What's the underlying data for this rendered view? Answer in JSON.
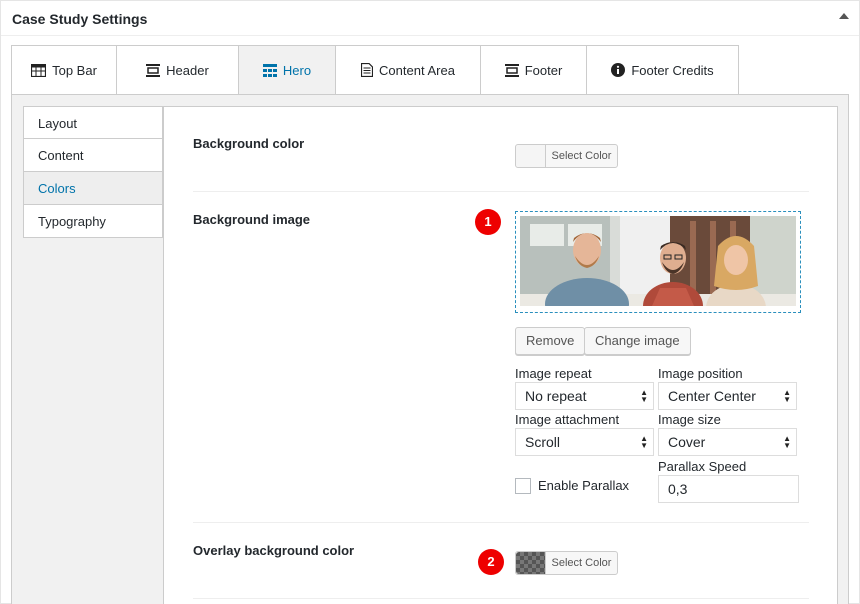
{
  "panel": {
    "title": "Case Study Settings"
  },
  "tabs": [
    {
      "label": "Top Bar",
      "icon": "table-icon"
    },
    {
      "label": "Header",
      "icon": "align-center-icon"
    },
    {
      "label": "Hero",
      "icon": "grid-icon"
    },
    {
      "label": "Content Area",
      "icon": "document-icon"
    },
    {
      "label": "Footer",
      "icon": "align-bottom-icon"
    },
    {
      "label": "Footer Credits",
      "icon": "info-icon"
    }
  ],
  "sidenav": [
    {
      "label": "Layout"
    },
    {
      "label": "Content"
    },
    {
      "label": "Colors"
    },
    {
      "label": "Typography"
    }
  ],
  "fields": {
    "bg_color_label": "Background color",
    "bg_color_button": "Select Color",
    "bg_image_label": "Background image",
    "remove_button": "Remove",
    "change_image_button": "Change image",
    "image_repeat_label": "Image repeat",
    "image_repeat_value": "No repeat",
    "image_position_label": "Image position",
    "image_position_value": "Center Center",
    "image_attachment_label": "Image attachment",
    "image_attachment_value": "Scroll",
    "image_size_label": "Image size",
    "image_size_value": "Cover",
    "enable_parallax_label": "Enable Parallax",
    "parallax_speed_label": "Parallax Speed",
    "parallax_speed_value": "0,3",
    "overlay_color_label": "Overlay background color",
    "overlay_color_button": "Select Color"
  },
  "badges": [
    "1",
    "2"
  ],
  "colors": {
    "accent": "#0073aa",
    "badge": "#e00000"
  }
}
